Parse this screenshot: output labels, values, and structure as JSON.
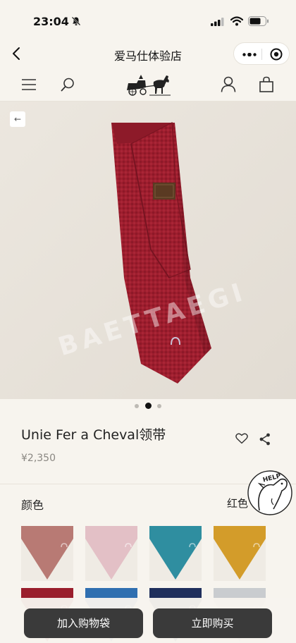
{
  "status_bar": {
    "time": "23:04"
  },
  "miniprogram": {
    "title": "爱马仕体验店"
  },
  "product": {
    "title": "Unie Fer a Cheval领带",
    "price": "¥2,350",
    "color_label": "颜色",
    "color_value": "红色",
    "gallery_watermark": "BAETTAEGI",
    "gallery_images": 3,
    "active_image": 2
  },
  "help_badge": {
    "label": "HELP"
  },
  "swatches": [
    {
      "name": "rose",
      "color": "#b87a74"
    },
    {
      "name": "pink",
      "color": "#e3c0c6"
    },
    {
      "name": "teal",
      "color": "#2f8ea0"
    },
    {
      "name": "mustard",
      "color": "#d39c2a"
    },
    {
      "name": "red",
      "color": "#9a1e2c"
    },
    {
      "name": "blue",
      "color": "#2f6fb0"
    },
    {
      "name": "navy",
      "color": "#1f2f5c"
    },
    {
      "name": "grey",
      "color": "#c9cccf"
    }
  ],
  "buttons": {
    "add_to_cart": "加入购物袋",
    "buy_now": "立即购买"
  },
  "colors": {
    "tie_red": "#9e1e2e",
    "button_dark": "#3a3a3a",
    "background": "#f7f4ee"
  }
}
